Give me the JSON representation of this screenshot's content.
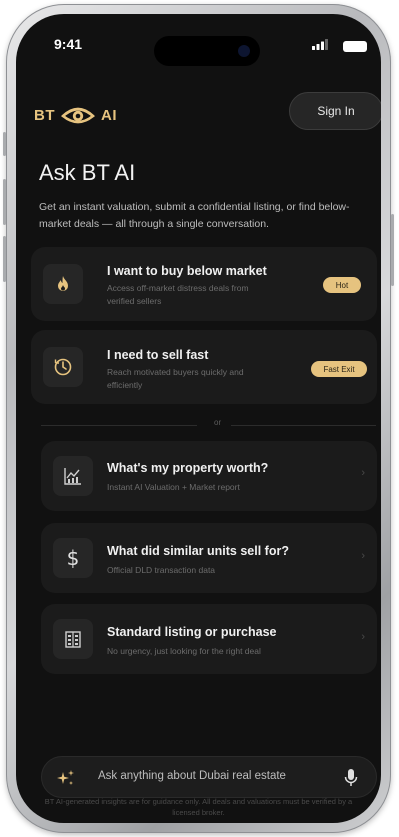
{
  "status": {
    "time": "9:41"
  },
  "header": {
    "logo_left": "BT",
    "logo_right": "AI",
    "signin_label": "Sign In"
  },
  "main": {
    "title": "Ask BT AI",
    "subtitle": "Get an instant valuation, submit a confidential listing, or find below-market deals — all through a single conversation."
  },
  "cards": [
    {
      "title": "I want to buy below market",
      "subtitle": "Access off-market distress deals from verified sellers",
      "badge": "Hot",
      "icon": "flame-icon"
    },
    {
      "title": "I need to sell fast",
      "subtitle": "Reach motivated buyers quickly and efficiently",
      "badge": "Fast Exit",
      "icon": "clock-dollar-icon"
    }
  ],
  "divider": {
    "label": "or"
  },
  "options": [
    {
      "title": "What's my property worth?",
      "subtitle": "Instant AI Valuation + Market report",
      "icon": "chart-icon"
    },
    {
      "title": "What did similar units sell for?",
      "subtitle": "Official DLD transaction data",
      "icon": "dollar-icon"
    },
    {
      "title": "Standard listing or purchase",
      "subtitle": "No urgency, just looking for the right deal",
      "icon": "building-icon"
    }
  ],
  "ask": {
    "placeholder": "Ask anything about Dubai real estate"
  },
  "disclaimer": "BT AI-generated insights are for guidance only. All deals and valuations must be verified by a licensed broker.",
  "colors": {
    "accent": "#e6c37f",
    "screen_bg": "#111111",
    "card_bg": "#1b1b1b"
  }
}
